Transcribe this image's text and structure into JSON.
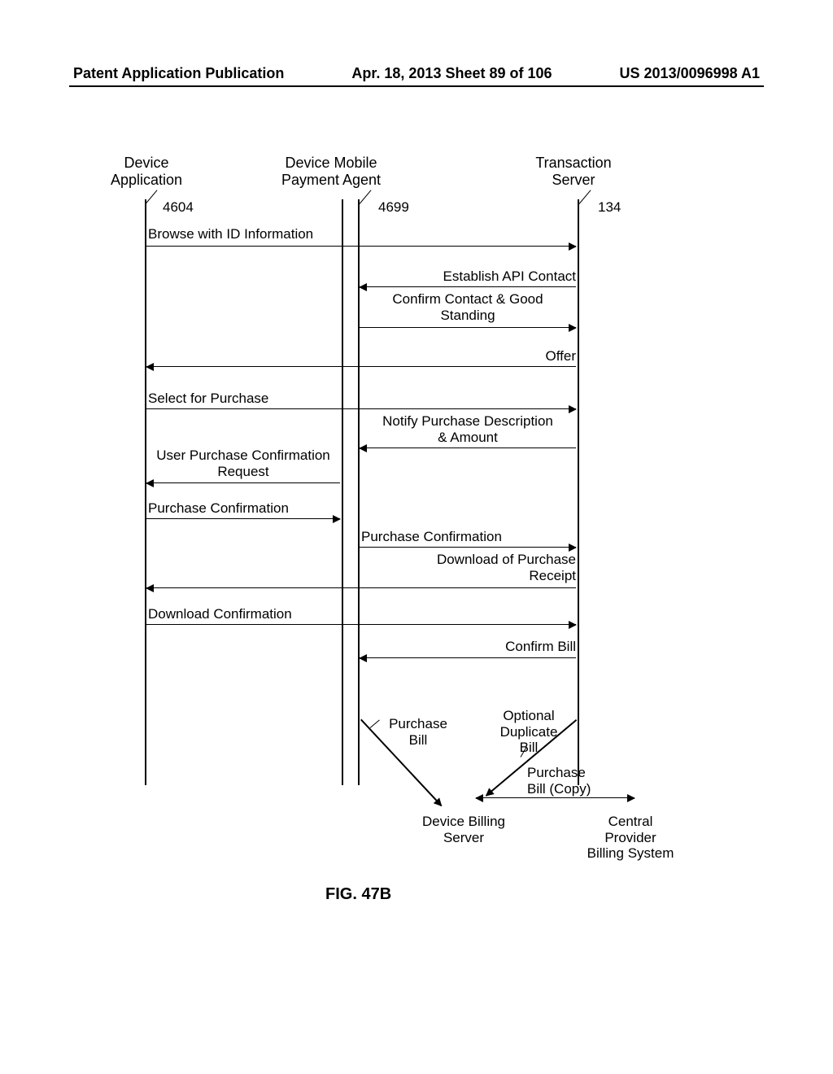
{
  "header": {
    "left": "Patent Application Publication",
    "center": "Apr. 18, 2013  Sheet 89 of 106",
    "right": "US 2013/0096998 A1"
  },
  "columns": {
    "device_app": "Device\nApplication",
    "payment_agent": "Device Mobile\nPayment Agent",
    "transaction_server": "Transaction\nServer"
  },
  "refs": {
    "r4604": "4604",
    "r4699": "4699",
    "r134": "134"
  },
  "msgs": {
    "browse": "Browse with ID Information",
    "api": "Establish API Contact",
    "confirm_standing": "Confirm Contact & Good\nStanding",
    "offer": "Offer",
    "select": "Select for Purchase",
    "notify": "Notify Purchase Description\n& Amount",
    "upc_req": "User Purchase Confirmation\nRequest",
    "pc1": "Purchase Confirmation",
    "pc2": "Purchase Confirmation",
    "dlreceipt": "Download of Purchase\nReceipt",
    "dlconf": "Download Confirmation",
    "confirm_bill": "Confirm Bill",
    "purchase_bill": "Purchase\nBill",
    "opt_dup": "Optional\nDuplicate\nBill",
    "bill_copy": "Purchase\nBill (Copy)"
  },
  "bottom_servers": {
    "billing": "Device Billing\nServer",
    "central": "Central\nProvider\nBilling System"
  },
  "figure_title": "FIG. 47B"
}
